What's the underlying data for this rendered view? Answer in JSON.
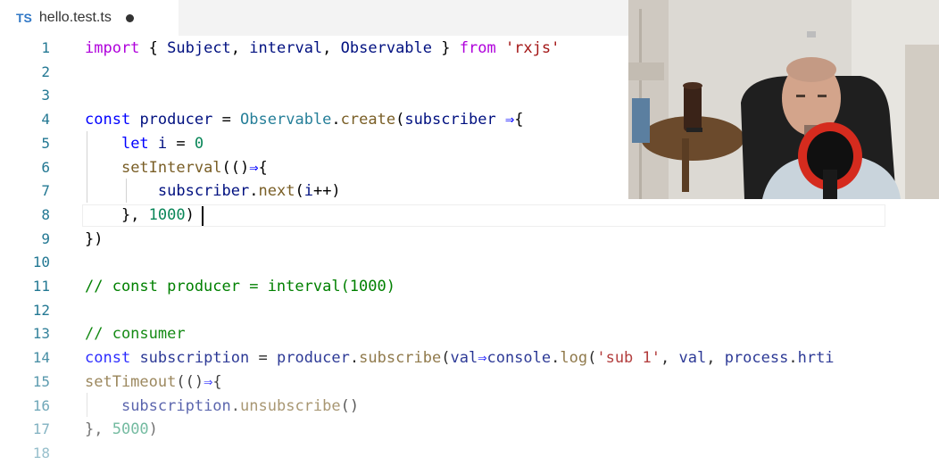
{
  "tab": {
    "lang_badge": "TS",
    "title": "hello.test.ts"
  },
  "lines": [
    {
      "n": "1",
      "tokens": [
        [
          "kw2",
          "import"
        ],
        [
          "pn",
          " { "
        ],
        [
          "id",
          "Subject"
        ],
        [
          "pn",
          ", "
        ],
        [
          "id",
          "interval"
        ],
        [
          "pn",
          ", "
        ],
        [
          "id",
          "Observable"
        ],
        [
          "pn",
          " } "
        ],
        [
          "kw2",
          "from"
        ],
        [
          "pn",
          " "
        ],
        [
          "str",
          "'rxjs'"
        ]
      ]
    },
    {
      "n": "2",
      "tokens": []
    },
    {
      "n": "3",
      "tokens": []
    },
    {
      "n": "4",
      "tokens": [
        [
          "kw",
          "const"
        ],
        [
          "pn",
          " "
        ],
        [
          "id",
          "producer"
        ],
        [
          "pn",
          " = "
        ],
        [
          "ty",
          "Observable"
        ],
        [
          "pn",
          "."
        ],
        [
          "fn",
          "create"
        ],
        [
          "pn",
          "("
        ],
        [
          "id",
          "subscriber"
        ],
        [
          "pn",
          " "
        ],
        [
          "op",
          "⇒"
        ],
        [
          "pn",
          "{"
        ]
      ]
    },
    {
      "n": "5",
      "tokens": [
        [
          "pn",
          "    "
        ],
        [
          "kw",
          "let"
        ],
        [
          "pn",
          " "
        ],
        [
          "id",
          "i"
        ],
        [
          "pn",
          " = "
        ],
        [
          "num",
          "0"
        ]
      ]
    },
    {
      "n": "6",
      "tokens": [
        [
          "pn",
          "    "
        ],
        [
          "fn",
          "setInterval"
        ],
        [
          "pn",
          "(()"
        ],
        [
          "op",
          "⇒"
        ],
        [
          "pn",
          "{"
        ]
      ]
    },
    {
      "n": "7",
      "tokens": [
        [
          "pn",
          "        "
        ],
        [
          "id",
          "subscriber"
        ],
        [
          "pn",
          "."
        ],
        [
          "fn",
          "next"
        ],
        [
          "pn",
          "("
        ],
        [
          "id",
          "i"
        ],
        [
          "pn",
          "++)"
        ]
      ]
    },
    {
      "n": "8",
      "tokens": [
        [
          "pn",
          "    }, "
        ],
        [
          "num",
          "1000"
        ],
        [
          "pn",
          ")"
        ]
      ]
    },
    {
      "n": "9",
      "tokens": [
        [
          "pn",
          "})"
        ]
      ]
    },
    {
      "n": "10",
      "tokens": []
    },
    {
      "n": "11",
      "tokens": [
        [
          "cm",
          "// const producer = interval(1000)"
        ]
      ]
    },
    {
      "n": "12",
      "tokens": []
    },
    {
      "n": "13",
      "tokens": [
        [
          "cm",
          "// consumer"
        ]
      ]
    },
    {
      "n": "14",
      "tokens": [
        [
          "kw",
          "const"
        ],
        [
          "pn",
          " "
        ],
        [
          "id",
          "subscription"
        ],
        [
          "pn",
          " = "
        ],
        [
          "id",
          "producer"
        ],
        [
          "pn",
          "."
        ],
        [
          "fn",
          "subscribe"
        ],
        [
          "pn",
          "("
        ],
        [
          "id",
          "val"
        ],
        [
          "op",
          "⇒"
        ],
        [
          "id",
          "console"
        ],
        [
          "pn",
          "."
        ],
        [
          "fn",
          "log"
        ],
        [
          "pn",
          "("
        ],
        [
          "str",
          "'sub 1'"
        ],
        [
          "pn",
          ", "
        ],
        [
          "id",
          "val"
        ],
        [
          "pn",
          ", "
        ],
        [
          "id",
          "process"
        ],
        [
          "pn",
          "."
        ],
        [
          "id",
          "hrti"
        ]
      ]
    },
    {
      "n": "15",
      "tokens": [
        [
          "fn",
          "setTimeout"
        ],
        [
          "pn",
          "(()"
        ],
        [
          "op",
          "⇒"
        ],
        [
          "pn",
          "{"
        ]
      ]
    },
    {
      "n": "16",
      "tokens": [
        [
          "pn",
          "    "
        ],
        [
          "id",
          "subscription"
        ],
        [
          "pn",
          "."
        ],
        [
          "fn",
          "unsubscribe"
        ],
        [
          "pn",
          "()"
        ]
      ]
    },
    {
      "n": "17",
      "tokens": [
        [
          "pn",
          "}, "
        ],
        [
          "num",
          "5000"
        ],
        [
          "pn",
          ")"
        ]
      ]
    },
    {
      "n": "18",
      "tokens": []
    }
  ],
  "colors": {
    "accent": "#3178c6",
    "line_number": "#237893"
  }
}
